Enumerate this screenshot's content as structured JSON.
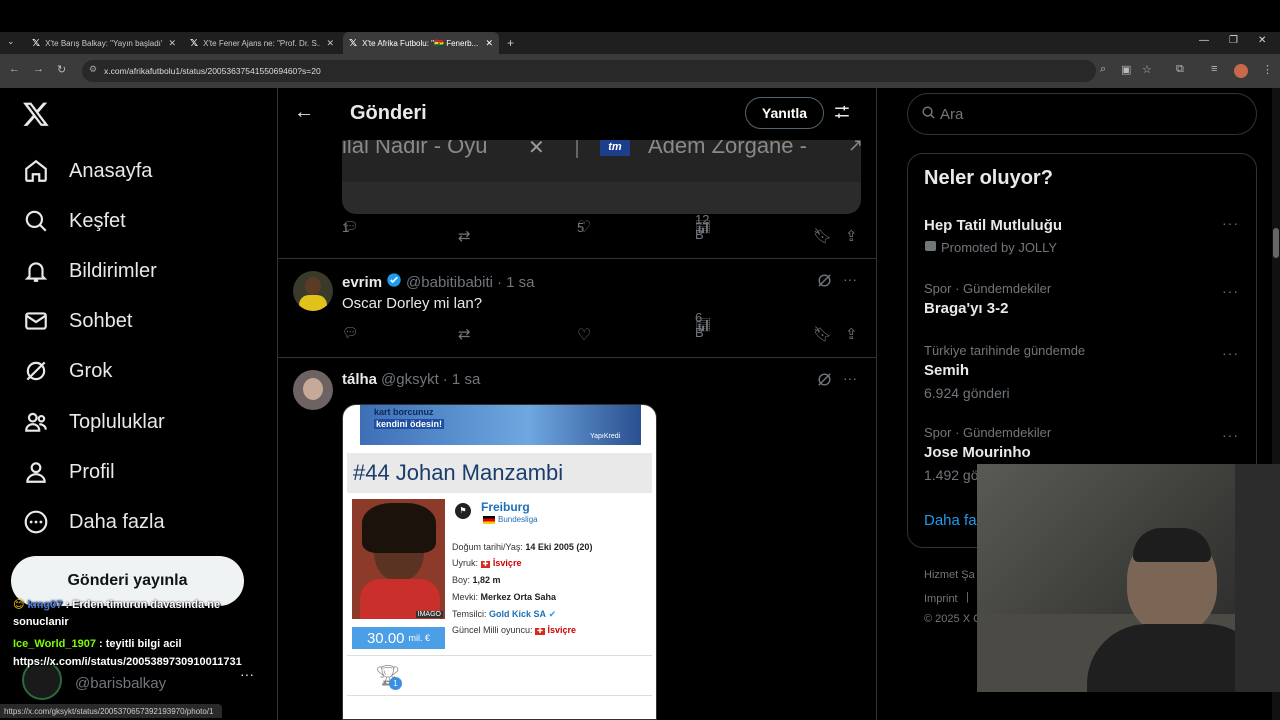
{
  "browser": {
    "tabs": [
      {
        "title": "X'te Barış Balkay: \"Yayın başladı\"",
        "active": false
      },
      {
        "title": "X'te Fener Ajans ne: \"Prof. Dr. S...",
        "active": false
      },
      {
        "title": "X'te Afrika Futbolu: \"🇬🇭 Fenerb...",
        "active": true
      }
    ],
    "url": "x.com/afrikafutbolu1/status/2005363754155069460?s=20",
    "status_url": "https://x.com/gksykt/status/2005370657392193970/photo/1"
  },
  "nav": {
    "items": [
      {
        "label": "Anasayfa",
        "icon": "home-icon"
      },
      {
        "label": "Keşfet",
        "icon": "search-icon"
      },
      {
        "label": "Bildirimler",
        "icon": "bell-icon"
      },
      {
        "label": "Sohbet",
        "icon": "mail-icon"
      },
      {
        "label": "Grok",
        "icon": "grok-icon"
      },
      {
        "label": "Topluluklar",
        "icon": "communities-icon"
      },
      {
        "label": "Profil",
        "icon": "person-icon"
      },
      {
        "label": "Daha fazla",
        "icon": "more-circle-icon"
      }
    ],
    "post_button": "Gönderi yayınla",
    "account_handle": "@barisbalkay"
  },
  "header": {
    "title": "Gönderi",
    "reply_button": "Yanıtla"
  },
  "embedded_top": {
    "left_text": "ilal Nadir - Oyu",
    "right_text": "Adem Zorgane -",
    "badge": "tm"
  },
  "first_actions": {
    "replies": "1",
    "likes": "5",
    "views": "12 B"
  },
  "replies": [
    {
      "name": "evrim",
      "handle": "@babitibabiti",
      "time": "· 1 sa",
      "text": "Oscar Dorley mi lan?",
      "views": "6 B"
    },
    {
      "name": "tálha",
      "handle": "@gksykt",
      "time": "· 1 sa"
    }
  ],
  "card": {
    "banner_line1": "kart borcunuz",
    "banner_line2": "kendini ödesin!",
    "banner_brand": "YapıKredi",
    "player_number": "#44",
    "first_name": "Johan",
    "last_name": "Manzambi",
    "club": "Freiburg",
    "league": "Bundesliga",
    "birth_label": "Doğum tarihi/Yaş:",
    "birth_value": "14 Eki 2005 (20)",
    "nationality_label": "Uyruk:",
    "nationality_value": "İsviçre",
    "height_label": "Boy:",
    "height_value": "1,82 m",
    "position_label": "Mevki:",
    "position_value": "Merkez Orta Saha",
    "agent_label": "Temsilci:",
    "agent_value": "Gold Kick SA",
    "intl_label": "Güncel Milli oyuncu:",
    "intl_value": "İsviçre",
    "market_value": "30.00",
    "market_unit": "mil. €",
    "image_credit": "IMAGO",
    "trophy_count": "1"
  },
  "search": {
    "placeholder": "Ara"
  },
  "trends": {
    "title": "Neler oluyor?",
    "items": [
      {
        "category": "",
        "title": "Hep Tatil Mutluluğu",
        "sub": "Promoted by JOLLY"
      },
      {
        "category": "Spor · Gündemdekiler",
        "title": "Braga'yı 3-2",
        "sub": ""
      },
      {
        "category": "Türkiye tarihinde gündemde",
        "title": "Semih",
        "sub": "6.924 gönderi"
      },
      {
        "category": "Spor · Gündemdekiler",
        "title": "Jose Mourinho",
        "sub": "1.492 gö"
      }
    ],
    "show_more": "Daha fa"
  },
  "footer": {
    "links": "Hizmet Şa",
    "imprint": "Imprint",
    "copyright": "© 2025 X C"
  },
  "chat": [
    {
      "user": "kmg07",
      "text": ": Erden timurun davasında ne"
    },
    {
      "user": "",
      "text": "sonuclanir"
    },
    {
      "user": "Ice_World_1907",
      "text": ": teyitli bilgi acil"
    },
    {
      "user": "",
      "text": "https://x.com/i/status/2005389730910011731"
    }
  ],
  "colors": {
    "accent": "#1d9bf0",
    "background": "#000000",
    "border": "#2f3336",
    "muted": "#71767b"
  }
}
